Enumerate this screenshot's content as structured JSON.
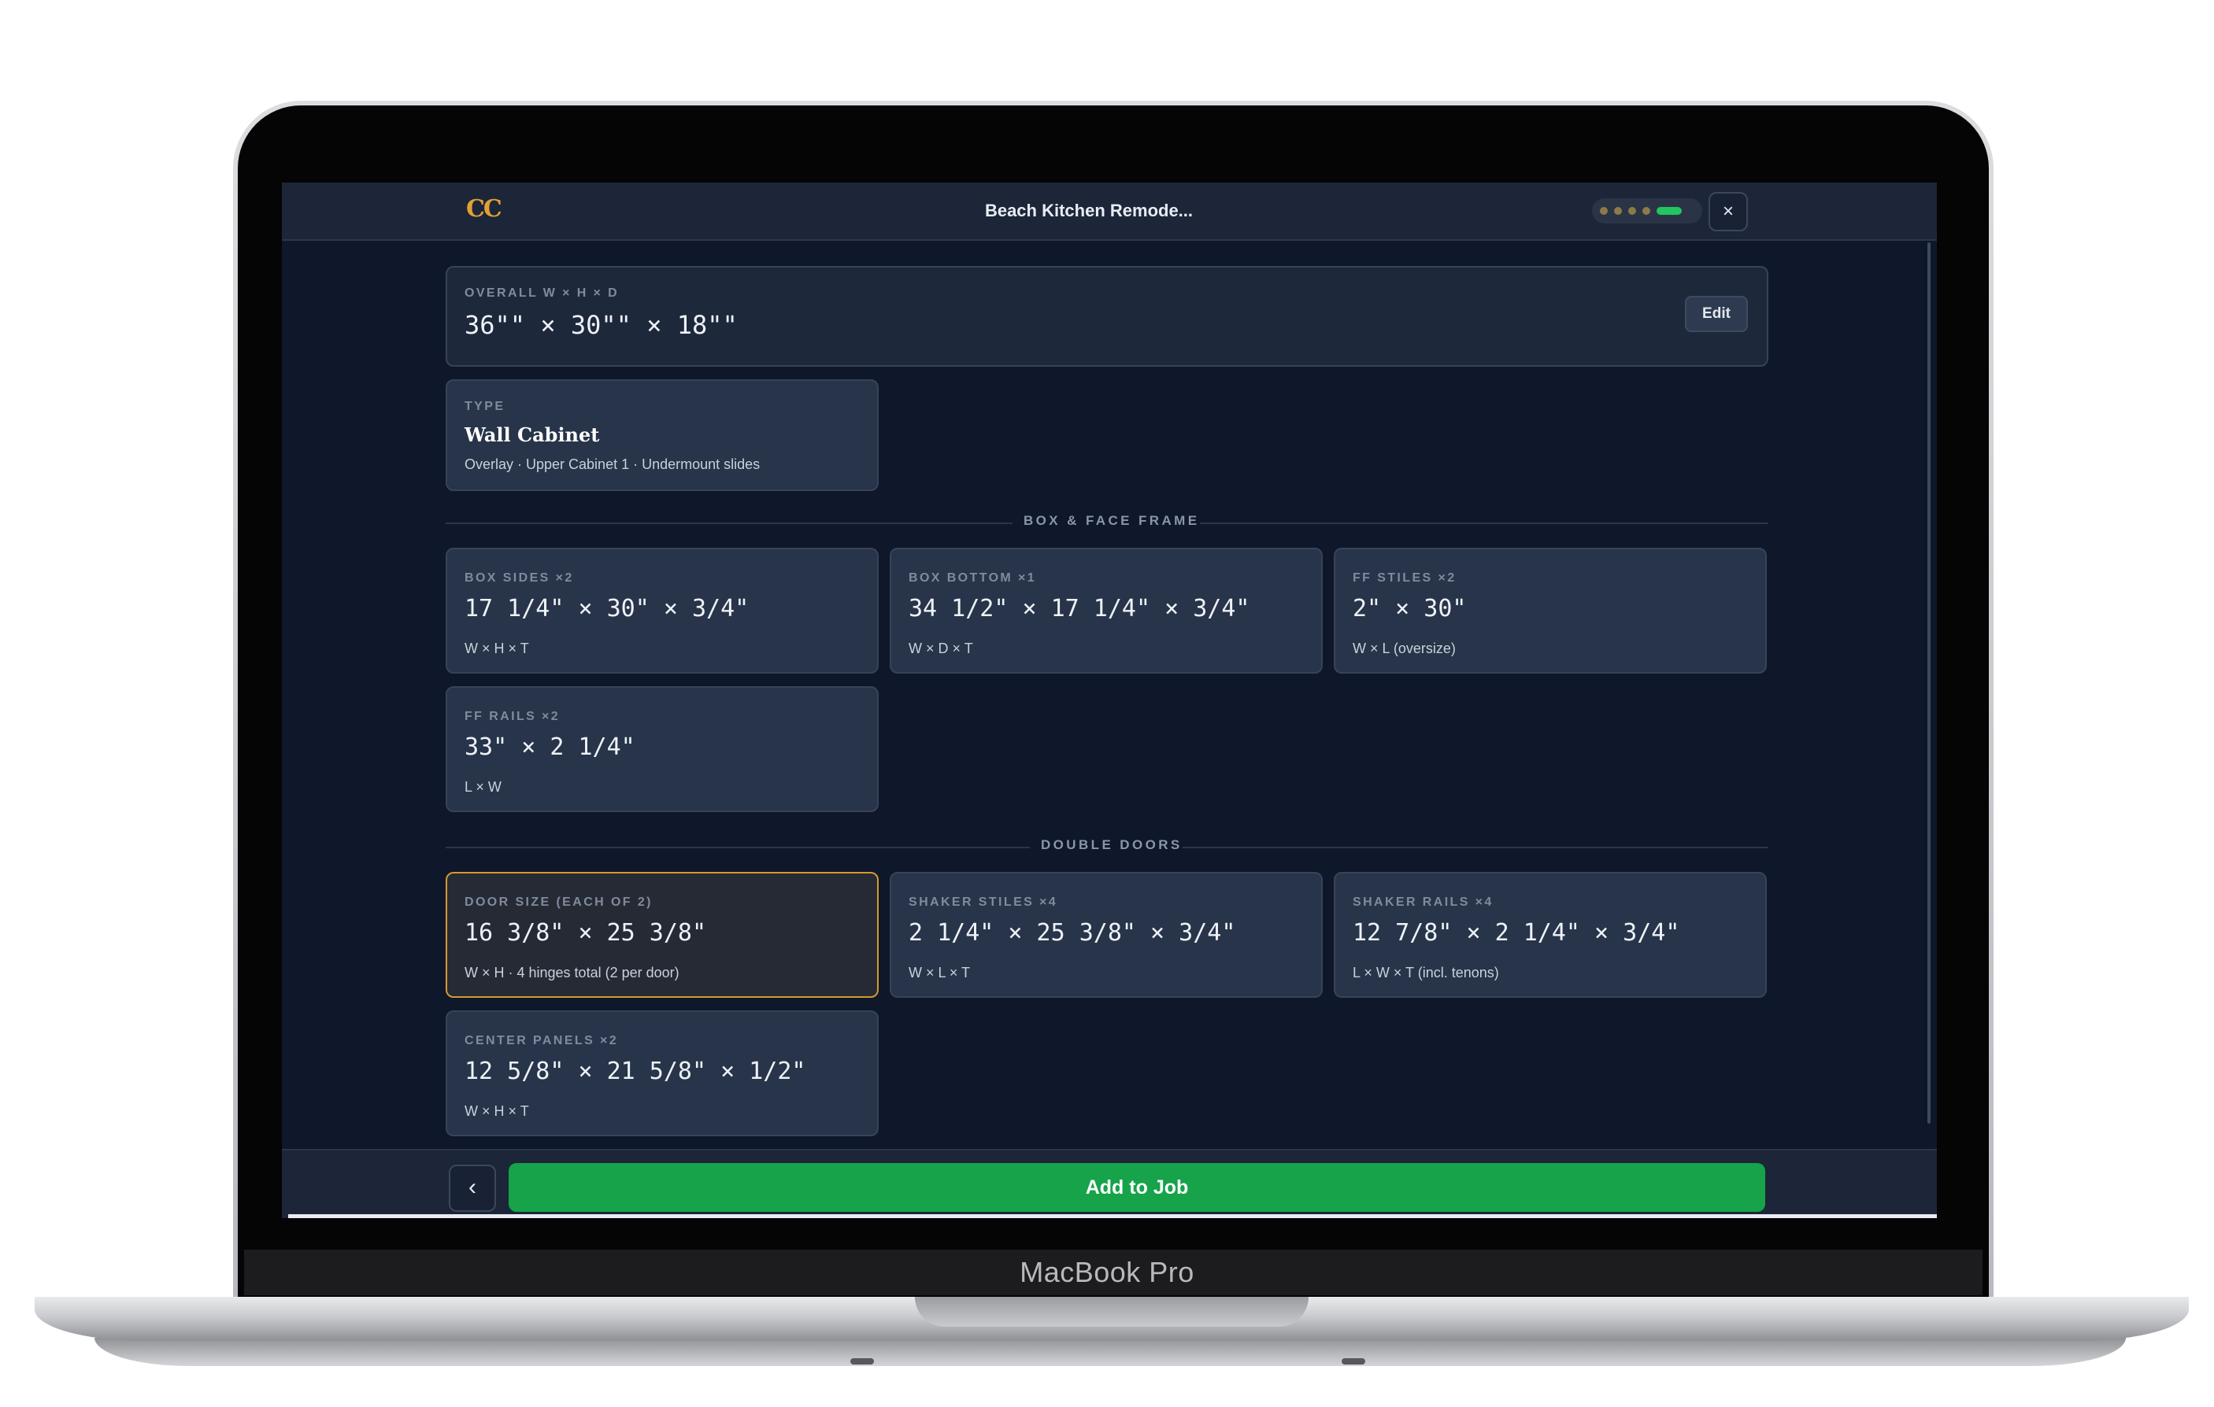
{
  "device": {
    "brand_label": "MacBook Pro"
  },
  "app": {
    "logo_text": "CC",
    "title": "Beach Kitchen Remode...",
    "progress": {
      "steps_total": 5,
      "current_step": 5
    },
    "close_label": "×"
  },
  "overall": {
    "label": "OVERALL W × H × D",
    "value": "36\"\" × 30\"\" × 18\"\"",
    "edit_label": "Edit"
  },
  "type_card": {
    "label": "TYPE",
    "title": "Wall Cabinet",
    "detail": "Overlay · Upper Cabinet 1 · Undermount slides"
  },
  "sections": [
    {
      "title": "BOX & FACE FRAME",
      "cards": [
        {
          "label": "BOX SIDES ×2",
          "value": "17 1/4\" × 30\" × 3/4\"",
          "sub": "W × H × T"
        },
        {
          "label": "BOX BOTTOM ×1",
          "value": "34 1/2\" × 17 1/4\" × 3/4\"",
          "sub": "W × D × T"
        },
        {
          "label": "FF STILES ×2",
          "value": "2\" × 30\"",
          "sub": "W × L (oversize)"
        },
        {
          "label": "FF RAILS ×2",
          "value": "33\" × 2 1/4\"",
          "sub": "L × W"
        }
      ]
    },
    {
      "title": "DOUBLE DOORS",
      "cards": [
        {
          "label": "DOOR SIZE (EACH OF 2)",
          "value": "16 3/8\" × 25 3/8\"",
          "sub": "W × H · 4 hinges total (2 per door)",
          "highlighted": true
        },
        {
          "label": "SHAKER STILES ×4",
          "value": "2 1/4\" × 25 3/8\" × 3/4\"",
          "sub": "W × L × T"
        },
        {
          "label": "SHAKER RAILS ×4",
          "value": "12 7/8\" × 2 1/4\" × 3/4\"",
          "sub": "L × W × T (incl. tenons)"
        },
        {
          "label": "CENTER PANELS ×2",
          "value": "12 5/8\" × 21 5/8\" × 1/2\"",
          "sub": "W × H × T"
        }
      ]
    }
  ],
  "footer": {
    "back_label": "‹",
    "primary_label": "Add to Job"
  },
  "colors": {
    "accent_gold": "#d49a2c",
    "primary_green": "#16a34a",
    "progress_green": "#22c55e",
    "screen_bg": "#0f172a",
    "card_bg": "#273449"
  }
}
